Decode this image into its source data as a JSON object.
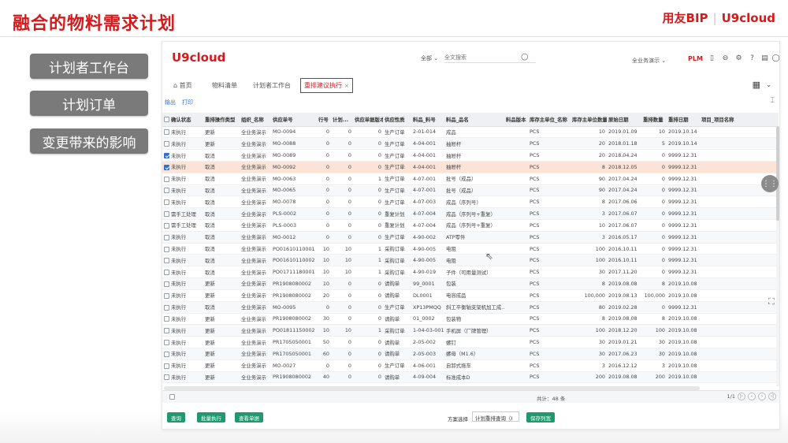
{
  "slide": {
    "title": "融合的物料需求计划",
    "brand_left": "用友BIP",
    "brand_right": "U9cloud"
  },
  "left_buttons": [
    {
      "label": "计划者工作台"
    },
    {
      "label": "计划订单"
    },
    {
      "label": "变更带来的影响"
    }
  ],
  "app": {
    "logo": "U9cloud",
    "search": {
      "scope": "全部",
      "placeholder": "全文搜索"
    },
    "org": "全业务演示",
    "plm_label": "PLM",
    "tabs": [
      {
        "label": "首页"
      },
      {
        "label": "物料清单"
      },
      {
        "label": "计划者工作台"
      },
      {
        "label": "重排建议执行"
      }
    ],
    "toolbar": {
      "export": "输出",
      "print": "打印"
    },
    "table": {
      "columns": [
        "确认状态",
        "重排操作类型",
        "组织_名称",
        "供应单号",
        "行号",
        "计划...",
        "供应单据版本",
        "供应性质",
        "料品_料号",
        "料品_品名",
        "料品版本",
        "库存主单位_名称",
        "库存主单位数量",
        "原始日期",
        "重排数量",
        "重排日期",
        "项目_项目名称"
      ],
      "rows": [
        {
          "checked": false,
          "c": [
            "未执行",
            "更新",
            "全业务演示",
            "MO-0094",
            "0",
            "0",
            "0",
            "生产订单",
            "2-01-014",
            "成品",
            "",
            "PCS",
            "10",
            "2019.01.09",
            "10",
            "2019.10.14",
            ""
          ]
        },
        {
          "checked": false,
          "c": [
            "未执行",
            "更新",
            "全业务演示",
            "MO-0088",
            "0",
            "0",
            "0",
            "生产订单",
            "4-04-001",
            "抽屉杆",
            "",
            "PCS",
            "20",
            "2018.01.18",
            "5",
            "2019.10.14",
            ""
          ]
        },
        {
          "checked": true,
          "c": [
            "未执行",
            "取消",
            "全业务演示",
            "MO-0089",
            "0",
            "0",
            "0",
            "生产订单",
            "4-04-001",
            "抽屉杆",
            "",
            "PCS",
            "20",
            "2018.04.24",
            "0",
            "9999.12.31",
            ""
          ]
        },
        {
          "checked": true,
          "c": [
            "未执行",
            "取消",
            "全业务演示",
            "MO-0092",
            "0",
            "0",
            "0",
            "生产订单",
            "4-04-001",
            "抽屉杆",
            "",
            "PCS",
            "8",
            "2018.12.05",
            "0",
            "9999.12.31",
            ""
          ]
        },
        {
          "checked": false,
          "c": [
            "未执行",
            "取消",
            "全业务演示",
            "MO-0063",
            "0",
            "0",
            "1",
            "生产订单",
            "4-07-001",
            "批号（成品）",
            "",
            "PCS",
            "90",
            "2017.04.24",
            "0",
            "9999.12.31",
            ""
          ]
        },
        {
          "checked": false,
          "c": [
            "未执行",
            "取消",
            "全业务演示",
            "MO-0065",
            "0",
            "0",
            "0",
            "生产订单",
            "4-07-001",
            "批号（成品）",
            "",
            "PCS",
            "90",
            "2017.04.24",
            "0",
            "9999.12.31",
            ""
          ]
        },
        {
          "checked": false,
          "c": [
            "未执行",
            "取消",
            "全业务演示",
            "MO-0078",
            "0",
            "0",
            "0",
            "生产订单",
            "4-07-003",
            "成品（序列号）",
            "",
            "PCS",
            "8",
            "2017.06.06",
            "0",
            "9999.12.31",
            ""
          ]
        },
        {
          "checked": false,
          "c": [
            "需手工处理",
            "取消",
            "全业务演示",
            "PLS-0002",
            "0",
            "0",
            "0",
            "重复计划",
            "4-07-004",
            "成品（序列号+重复）",
            "",
            "PCS",
            "3",
            "2017.06.07",
            "0",
            "9999.12.31",
            ""
          ]
        },
        {
          "checked": false,
          "c": [
            "需手工处理",
            "取消",
            "全业务演示",
            "PLS-0003",
            "0",
            "0",
            "0",
            "重复计划",
            "4-07-004",
            "成品（序列号+重复）",
            "",
            "PCS",
            "10",
            "2017.06.07",
            "0",
            "9999.12.31",
            ""
          ]
        },
        {
          "checked": false,
          "c": [
            "未执行",
            "取消",
            "全业务演示",
            "MO-0012",
            "0",
            "0",
            "0",
            "生产订单",
            "4-90-002",
            "ATP零件",
            "",
            "PCS",
            "3",
            "2016.05.17",
            "0",
            "9999.12.31",
            ""
          ]
        },
        {
          "checked": false,
          "c": [
            "未执行",
            "取消",
            "全业务演示",
            "PO01610110001",
            "10",
            "10",
            "1",
            "采购订单",
            "4-90-005",
            "电阻",
            "",
            "PCS",
            "100",
            "2016.10.11",
            "0",
            "9999.12.31",
            ""
          ]
        },
        {
          "checked": false,
          "c": [
            "未执行",
            "取消",
            "全业务演示",
            "PO01610110002",
            "10",
            "10",
            "1",
            "采购订单",
            "4-90-005",
            "电阻",
            "",
            "PCS",
            "100",
            "2016.10.11",
            "0",
            "9999.12.31",
            ""
          ]
        },
        {
          "checked": false,
          "c": [
            "未执行",
            "取消",
            "全业务演示",
            "PO01711180001",
            "10",
            "10",
            "1",
            "采购订单",
            "4-90-019",
            "子件（可用量测试）",
            "",
            "PCS",
            "30",
            "2017.11.20",
            "0",
            "9999.12.31",
            ""
          ]
        },
        {
          "checked": false,
          "c": [
            "未执行",
            "更新",
            "全业务演示",
            "PR1908080002",
            "10",
            "0",
            "0",
            "请购单",
            "99_0001",
            "包装",
            "",
            "PCS",
            "8",
            "2019.08.08",
            "8",
            "2019.10.08",
            ""
          ]
        },
        {
          "checked": false,
          "c": [
            "未执行",
            "更新",
            "全业务演示",
            "PR1908080002",
            "20",
            "0",
            "0",
            "请购单",
            "DL0001",
            "电容成品",
            "",
            "PCS",
            "100,000",
            "2019.08.13",
            "100,000",
            "2019.10.08",
            ""
          ]
        },
        {
          "checked": false,
          "c": [
            "未执行",
            "取消",
            "全业务演示",
            "MO-0095",
            "0",
            "0",
            "0",
            "生产订单",
            "XP13PMQQ",
            "斜工平衡轴支架机加工成...",
            "",
            "PCS",
            "80",
            "2019.02.28",
            "0",
            "9999.12.31",
            ""
          ]
        },
        {
          "checked": false,
          "c": [
            "未执行",
            "更新",
            "全业务演示",
            "PR1908080002",
            "30",
            "0",
            "0",
            "请购单",
            "01_0002",
            "包装物",
            "",
            "PCS",
            "8",
            "2019.08.08",
            "8",
            "2019.10.08",
            ""
          ]
        },
        {
          "checked": false,
          "c": [
            "未执行",
            "更新",
            "全业务演示",
            "PO01811150002",
            "10",
            "10",
            "1",
            "采购订单",
            "1-04-03-001",
            "手机屏（厂牌管理）",
            "",
            "PCS",
            "100",
            "2018.12.20",
            "100",
            "2019.10.08",
            ""
          ]
        },
        {
          "checked": false,
          "c": [
            "未执行",
            "更新",
            "全业务演示",
            "PR1705050001",
            "50",
            "0",
            "0",
            "请购单",
            "2-05-002",
            "螺钉",
            "",
            "PCS",
            "30",
            "2019.01.21",
            "30",
            "2019.10.08",
            ""
          ]
        },
        {
          "checked": false,
          "c": [
            "未执行",
            "更新",
            "全业务演示",
            "PR1705050001",
            "60",
            "0",
            "0",
            "请购单",
            "2-05-003",
            "螺母（M1.6）",
            "",
            "PCS",
            "30",
            "2017.06.23",
            "30",
            "2019.10.08",
            ""
          ]
        },
        {
          "checked": false,
          "c": [
            "未执行",
            "更新",
            "全业务演示",
            "MO-0027",
            "0",
            "0",
            "0",
            "生产订单",
            "4-06-001",
            "自卸式拖车",
            "",
            "PCS",
            "3",
            "2016.12.12",
            "3",
            "2019.10.08",
            ""
          ]
        },
        {
          "checked": false,
          "c": [
            "未执行",
            "更新",
            "全业务演示",
            "PR1908080002",
            "40",
            "0",
            "0",
            "请购单",
            "4-09-004",
            "标准成本D",
            "",
            "PCS",
            "200",
            "2019.08.08",
            "200",
            "2019.10.08",
            ""
          ]
        }
      ]
    },
    "footer": {
      "total": "共计：48 条",
      "page": "1/1"
    },
    "bottom_buttons": {
      "query": "查询",
      "batch_exec": "批量执行",
      "view_doc": "查看单据"
    },
    "scheme": {
      "label": "方案选择",
      "value": "计划重排查询（I",
      "save": "保存列宽"
    }
  },
  "colors": {
    "brand_red": "#d7191c",
    "green_button": "#1f9a6e",
    "highlight_row": "#fbe3d6",
    "checkbox_blue": "#2f6fd6"
  }
}
